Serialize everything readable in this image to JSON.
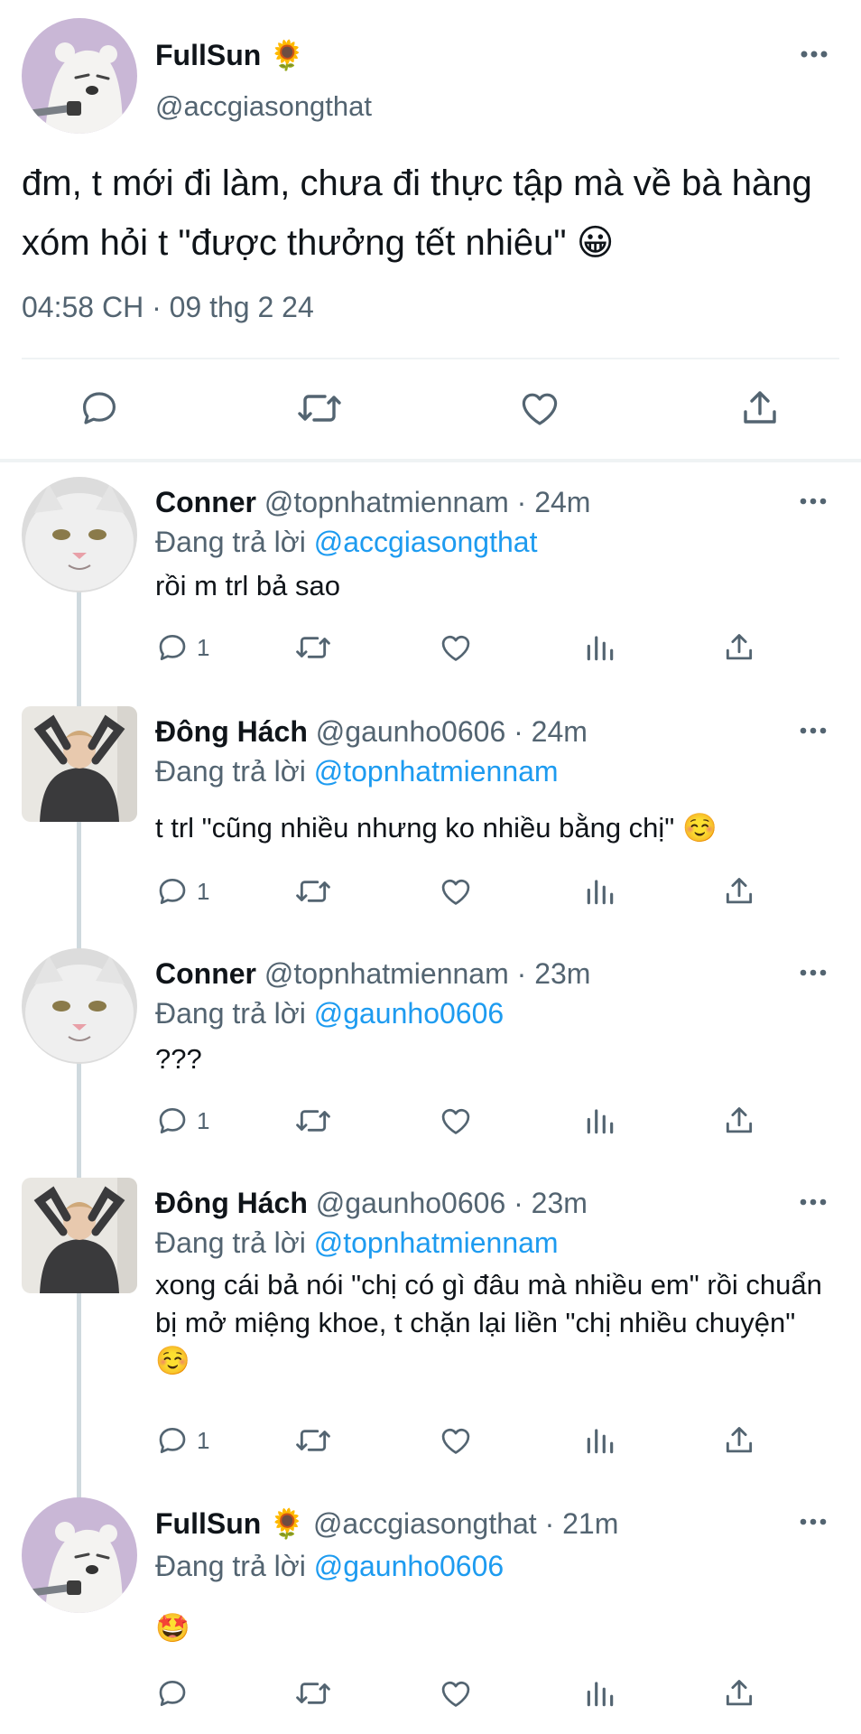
{
  "main_tweet": {
    "name": "FullSun",
    "name_emoji": "🌻",
    "handle": "@accgiasongthat",
    "text": "đm, t mới đi làm, chưa đi thực tập mà về bà hàng xóm hỏi t \"được thưởng tết nhiêu\"",
    "text_emoji": "😀",
    "timestamp": "04:58 CH · 09 thg 2 24"
  },
  "replies": [
    {
      "name": "Conner",
      "name_emoji": "",
      "handle": "@topnhatmiennam",
      "time": "· 24m",
      "replying_label": "Đang trả lời",
      "replying_to": "@accgiasongthat",
      "text": "rồi m trl bả sao",
      "text_emoji": "",
      "reply_count": "1"
    },
    {
      "name": "Đông Hách",
      "name_emoji": "",
      "handle": "@gaunho0606",
      "time": "· 24m",
      "replying_label": "Đang trả lời",
      "replying_to": "@topnhatmiennam",
      "text": "t trl \"cũng nhiều nhưng ko nhiều bằng chị\"",
      "text_emoji": "☺️",
      "reply_count": "1"
    },
    {
      "name": "Conner",
      "name_emoji": "",
      "handle": "@topnhatmiennam",
      "time": "· 23m",
      "replying_label": "Đang trả lời",
      "replying_to": "@gaunho0606",
      "text": "???",
      "text_emoji": "",
      "reply_count": "1"
    },
    {
      "name": "Đông Hách",
      "name_emoji": "",
      "handle": "@gaunho0606",
      "time": "· 23m",
      "replying_label": "Đang trả lời",
      "replying_to": "@topnhatmiennam",
      "text": "xong cái bả nói \"chị có gì đâu mà nhiều em\" rồi chuẩn bị mở miệng khoe, t chặn lại liền \"chị nhiều chuyện\"",
      "text_emoji": "☺️",
      "reply_count": "1"
    },
    {
      "name": "FullSun",
      "name_emoji": "🌻",
      "handle": "@accgiasongthat",
      "time": "· 21m",
      "replying_label": "Đang trả lời",
      "replying_to": "@gaunho0606",
      "text": "",
      "text_emoji": "🤩",
      "reply_count": ""
    }
  ],
  "icons": {
    "more": "more-horizontal-icon",
    "reply": "reply-bubble-icon",
    "retweet": "retweet-icon",
    "like": "heart-icon",
    "views": "views-bar-chart-icon",
    "share": "share-upload-icon"
  },
  "colors": {
    "link": "#1d9bf0",
    "secondary_text": "#536471",
    "icon": "#536471",
    "divider": "#eff3f4",
    "thread_line": "#cfd9de"
  }
}
